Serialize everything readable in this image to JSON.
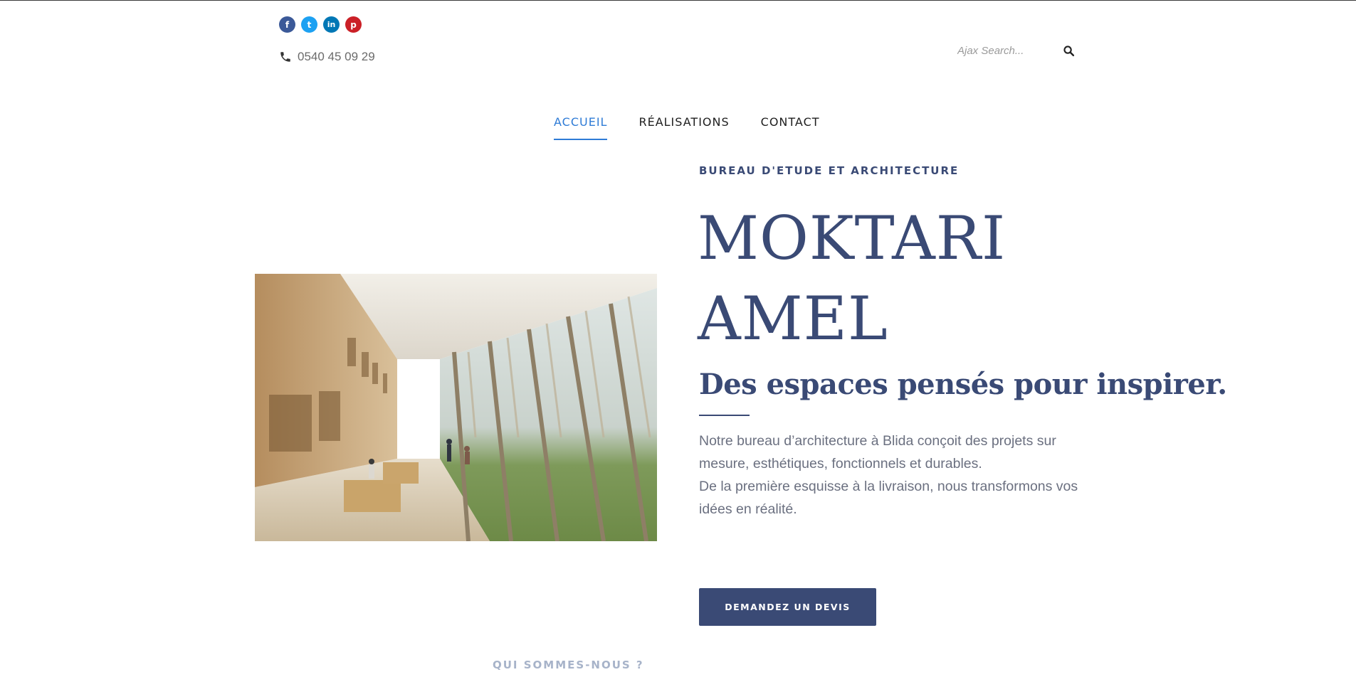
{
  "header": {
    "socials": [
      {
        "name": "facebook",
        "glyph": "f",
        "color": "#3b5998"
      },
      {
        "name": "twitter",
        "glyph": "t",
        "color": "#1da1f2"
      },
      {
        "name": "linkedin",
        "glyph": "in",
        "color": "#0077b5"
      },
      {
        "name": "pinterest",
        "glyph": "p",
        "color": "#cb2027"
      }
    ],
    "phone": "0540 45 09 29",
    "search": {
      "placeholder": "Ajax Search..."
    }
  },
  "nav": {
    "items": [
      {
        "label": "ACCUEIL",
        "active": true
      },
      {
        "label": "RÉALISATIONS",
        "active": false
      },
      {
        "label": "CONTACT",
        "active": false
      }
    ],
    "active_color": "#2e7bd6"
  },
  "hero": {
    "eyebrow": "BUREAU D'ETUDE ET ARCHITECTURE",
    "title_line1": "MOKTARI",
    "title_line2": "AMEL",
    "tagline": "Des espaces pensés pour inspirer.",
    "description_line1": "Notre bureau d’architecture à Blida conçoit des projets sur mesure, esthétiques, fonctionnels et durables.",
    "description_line2": "De la première esquisse à la livraison, nous transformons vos idées en réalité.",
    "cta_label": "DEMANDEZ UN DEVIS",
    "image_subject": "architectural interior gallery"
  },
  "section_next": {
    "label": "QUI SOMMES-NOUS ?"
  },
  "colors": {
    "brand": "#3a4a75",
    "accent": "#2e7bd6"
  }
}
